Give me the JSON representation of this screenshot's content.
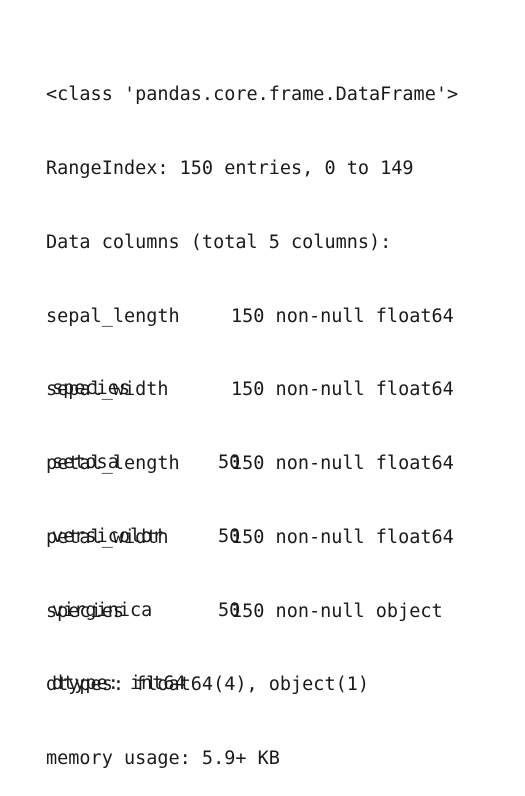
{
  "info": {
    "class_line": "<class 'pandas.core.frame.DataFrame'>",
    "range_index": "RangeIndex: 150 entries, 0 to 149",
    "data_columns": "Data columns (total 5 columns):",
    "columns": [
      {
        "name": "sepal_length",
        "info": "150 non-null float64"
      },
      {
        "name": "sepal_width",
        "info": "150 non-null float64"
      },
      {
        "name": "petal_length",
        "info": "150 non-null float64"
      },
      {
        "name": "petal_width",
        "info": "150 non-null float64"
      },
      {
        "name": "species",
        "info": "150 non-null object"
      }
    ],
    "dtypes": "dtypes: float64(4), object(1)",
    "memory": "memory usage: 5.9+ KB"
  },
  "value_counts": {
    "header": "species",
    "rows": [
      {
        "label": "setosa",
        "count": "50"
      },
      {
        "label": "versicolor",
        "count": "50"
      },
      {
        "label": "virginica",
        "count": "50"
      }
    ],
    "dtype": "dtype: int64"
  }
}
